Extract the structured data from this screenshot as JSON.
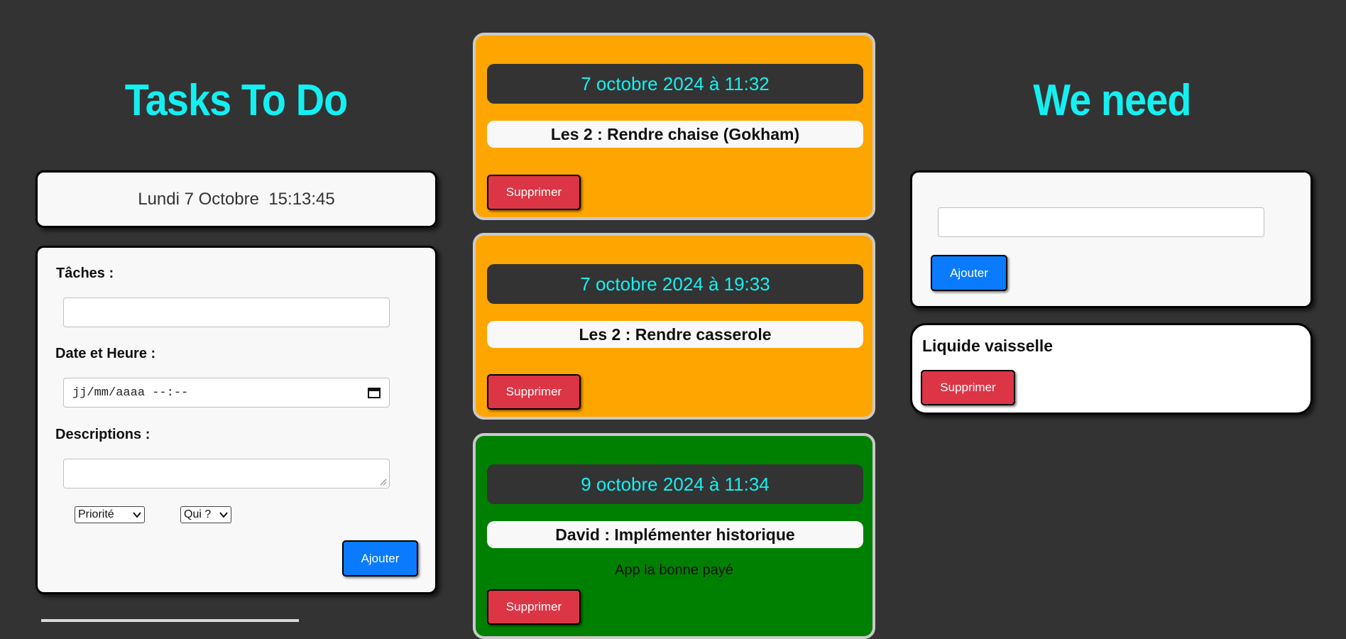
{
  "left": {
    "title": "Tasks To Do",
    "clock": "Lundi 7 Octobre  15:13:45",
    "form": {
      "task_label": "Tâches :",
      "datetime_label": "Date et Heure :",
      "datetime_placeholder": "jj/mm/aaaa --:--",
      "desc_label": "Descriptions :",
      "priority_selected": "Priorité",
      "who_selected": "Qui ?",
      "add_label": "Ajouter"
    }
  },
  "tasks": [
    {
      "date": "7 octobre 2024 à 11:32",
      "task": "Les 2 : Rendre chaise (Gokham)",
      "description": "",
      "color": "#FFA500",
      "delete_label": "Supprimer"
    },
    {
      "date": "7 octobre 2024 à 19:33",
      "task": "Les 2 : Rendre casserole",
      "description": "",
      "color": "#FFA500",
      "delete_label": "Supprimer"
    },
    {
      "date": "9 octobre 2024 à 11:34",
      "task": "David : Implémenter historique",
      "description": "App la bonne payé",
      "color": "#008000",
      "delete_label": "Supprimer"
    }
  ],
  "right": {
    "title": "We need",
    "add_label": "Ajouter",
    "items": [
      {
        "name": "Liquide vaisselle",
        "delete_label": "Supprimer"
      }
    ]
  },
  "colors": {
    "background": "#333333",
    "title": "#14F0F2",
    "primary_button": "#0A7BFF",
    "danger_button": "#DC3545",
    "card_pending": "#FFA500",
    "card_other": "#008000"
  }
}
